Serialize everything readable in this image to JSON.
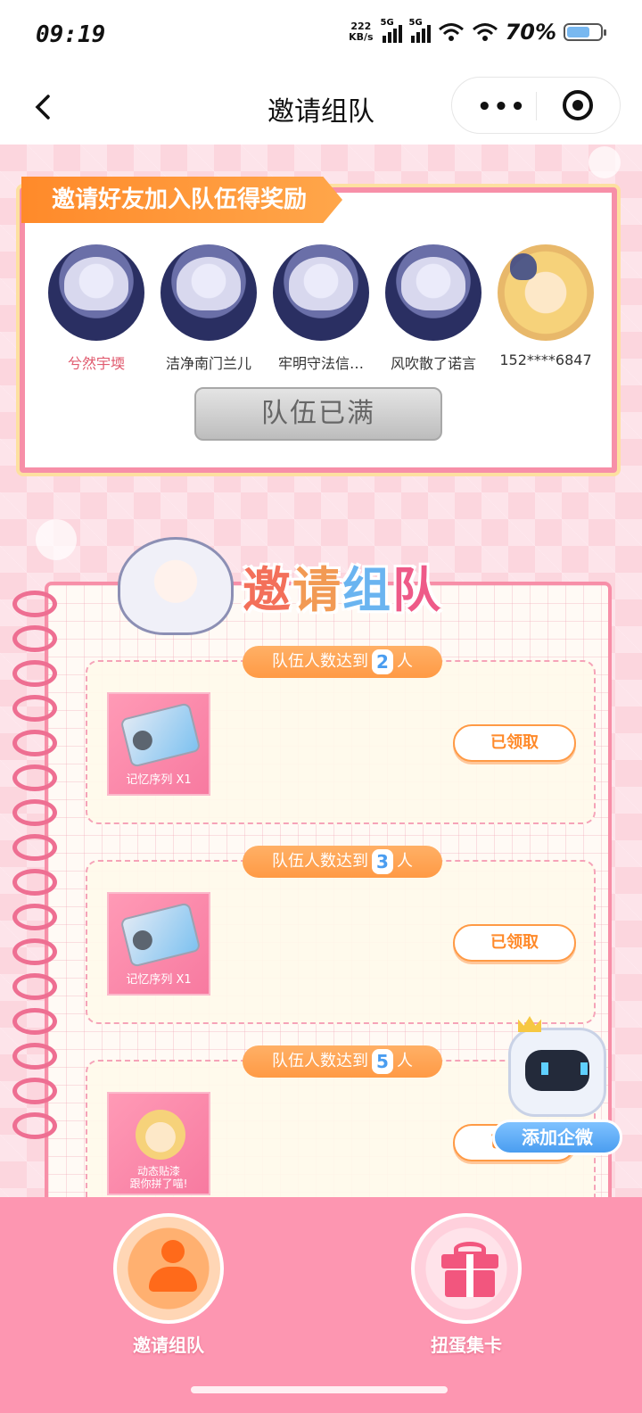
{
  "status_bar": {
    "time": "09:19",
    "net_speed_value": "222",
    "net_speed_unit": "KB/s",
    "sim1_label": "5G",
    "sim2_label": "5G",
    "battery_percent": "70%",
    "battery_level": 0.7
  },
  "nav": {
    "title": "邀请组队",
    "back_icon": "chevron-left-icon",
    "more_icon": "more-dots-icon",
    "close_icon": "target-circle-icon"
  },
  "invite_card": {
    "banner": "邀请好友加入队伍得奖励",
    "members": [
      {
        "name": "兮然宇堧",
        "highlight": true
      },
      {
        "name": "洁净南门兰儿",
        "highlight": false
      },
      {
        "name": "牢明守法信…",
        "highlight": false
      },
      {
        "name": "风吹散了诺言",
        "highlight": false
      },
      {
        "name": "152****6847",
        "highlight": false
      }
    ],
    "status_button": "队伍已满"
  },
  "section": {
    "title_chars": [
      "邀",
      "请",
      "组",
      "队"
    ]
  },
  "rewards": [
    {
      "tag_prefix": "队伍人数达到",
      "count": "2",
      "tag_suffix": "人",
      "item_label": "记忆序列 X1",
      "button": "已领取"
    },
    {
      "tag_prefix": "队伍人数达到",
      "count": "3",
      "tag_suffix": "人",
      "item_label": "记忆序列 X1",
      "button": "已领取"
    },
    {
      "tag_prefix": "队伍人数达到",
      "count": "5",
      "tag_suffix": "人",
      "item_label": "动态贴漆\n跟你拼了喵!",
      "button": "已领取"
    }
  ],
  "floating": {
    "wecom_button": "添加企微"
  },
  "tabbar": {
    "items": [
      {
        "label": "邀请组队",
        "icon": "people-icon",
        "active": true
      },
      {
        "label": "扭蛋集卡",
        "icon": "gift-icon",
        "active": false
      }
    ]
  },
  "colors": {
    "accent_orange": "#ff8a2a",
    "pink_border": "#f78fa8",
    "tab_bg": "#fd96b1",
    "wecom_blue": "#4a9df0"
  }
}
